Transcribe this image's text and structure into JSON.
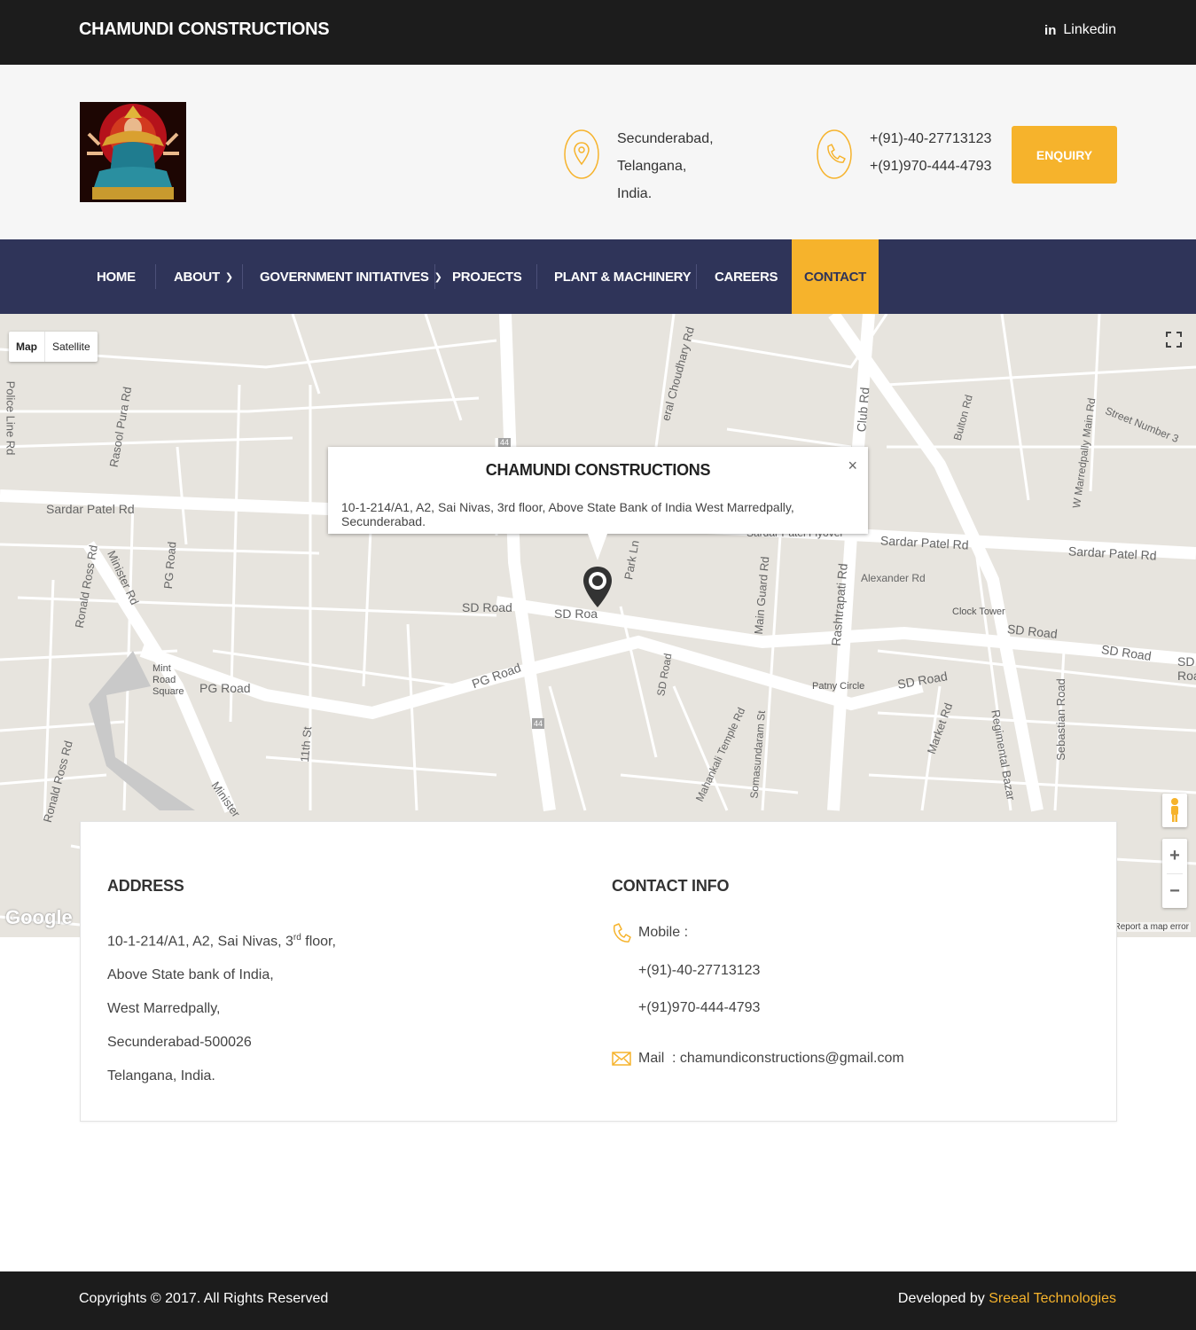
{
  "topbar": {
    "brand": "CHAMUNDI CONSTRUCTIONS",
    "linkedin_icon": "in",
    "linkedin_label": "Linkedin"
  },
  "header": {
    "location_line1": "Secunderabad, Telangana,",
    "location_line2": "India.",
    "phone1": "+(91)-40-27713123",
    "phone2": "+(91)970-444-4793",
    "enquiry_label": "ENQUIRY"
  },
  "nav": {
    "items": [
      {
        "label": "HOME"
      },
      {
        "label": "ABOUT"
      },
      {
        "label": "GOVERNMENT INITIATIVES"
      },
      {
        "label": "PROJECTS"
      },
      {
        "label": "PLANT & MACHINERY"
      },
      {
        "label": "CAREERS"
      },
      {
        "label": "CONTACT"
      }
    ],
    "active": "CONTACT"
  },
  "map": {
    "toggle_map": "Map",
    "toggle_satellite": "Satellite",
    "zoom_in": "+",
    "zoom_out": "−",
    "report": "Report a map error",
    "google": "Google",
    "infowindow_title": "CHAMUNDI CONSTRUCTIONS",
    "infowindow_address": "10-1-214/A1, A2, Sai Nivas, 3rd floor, Above State Bank of India West Marredpally, Secunderabad.",
    "infowindow_close": "×",
    "labels": {
      "sardar1": "Sardar Patel Rd",
      "sardar2": "Sardar Patel Rd",
      "sardar3": "Sardar Patel Rd",
      "flyover": "Sardar Patel Flyover",
      "sd1": "SD Road",
      "sd2": "SD Roa",
      "sd3": "SD Road",
      "sd4": "SD Road",
      "sd5": "SD Road",
      "sd6": "SD Road",
      "pg1": "PG Road",
      "pg2": "PG Road",
      "pg3": "PG Road",
      "club": "Club Rd",
      "rash": "Rashtrapati Rd",
      "alex": "Alexander Rd",
      "clock": "Clock Tower",
      "patny": "Patny Circle",
      "mint": "Mint Road Square",
      "park": "Park Ln",
      "mainguard": "Main Guard Rd",
      "market": "Market Rd",
      "regimental": "Regimental Bazar",
      "sebastian": "Sebastian Road",
      "bulton": "Bulton Rd",
      "wmarred": "W Marredpally Main Rd",
      "street3": "Street Number 3",
      "ronald1": "Ronald Ross Rd",
      "ronald2": "Ronald Ross Rd",
      "minister1": "Minister Rd",
      "minister2": "Minister",
      "rasool": "Rasool Pura Rd",
      "police": "Police Line Rd",
      "choudhary": "eral Choudhary Rd",
      "eleventh": "11th St",
      "mahankali": "Mahankali Temple Rd",
      "soma": "Somasundaram St",
      "sdroad2": "SD Road",
      "hw1": "44",
      "hw2": "44"
    }
  },
  "contact": {
    "address_heading": "ADDRESS",
    "address_line1_a": "10-1-214/A1, A2, Sai Nivas, 3",
    "address_line1_sup": "rd",
    "address_line1_b": " floor,",
    "address_line2": "Above State bank of India,",
    "address_line3": "West Marredpally,",
    "address_line4": "Secunderabad-500026",
    "address_line5": "Telangana, India.",
    "info_heading": "CONTACT INFO",
    "mobile_label": "Mobile :",
    "mobile1": "+(91)-40-27713123",
    "mobile2": "+(91)970-444-4793",
    "mail_label": "Mail",
    "mail_value": ": chamundiconstructions@gmail.com"
  },
  "footer": {
    "copyright": "Copyrights © 2017. All Rights Reserved",
    "developed_by": "Developed by ",
    "developer": "Sreeal Technologies"
  },
  "colors": {
    "accent": "#f6b32c",
    "nav_bg": "#2f3459",
    "topbar_bg": "#1c1c1c",
    "map_bg": "#e7e4de"
  },
  "icons": {
    "location": "map-pin-icon",
    "phone": "phone-icon",
    "mail": "envelope-icon",
    "linkedin": "linkedin-icon",
    "fullscreen": "fullscreen-icon",
    "pegman": "pegman-icon",
    "marker": "map-marker-icon"
  }
}
